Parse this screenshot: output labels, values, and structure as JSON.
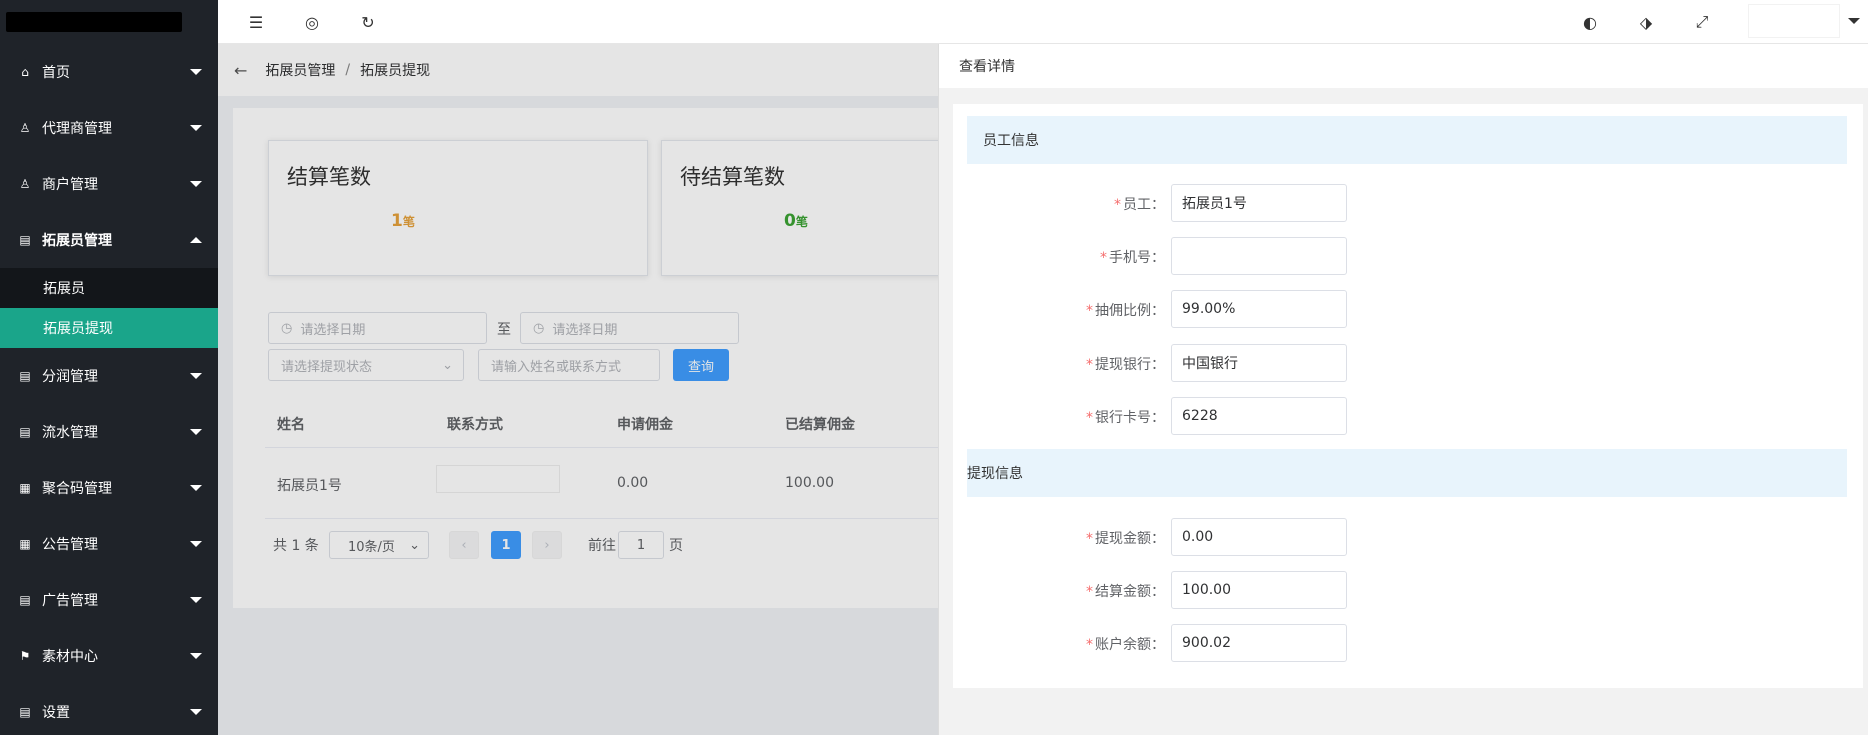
{
  "sidebar": {
    "menu": [
      {
        "label": "首页",
        "icon": "home-icon"
      },
      {
        "label": "代理商管理",
        "icon": "user-icon"
      },
      {
        "label": "商户管理",
        "icon": "user-icon"
      },
      {
        "label": "拓展员管理",
        "icon": "clipboard-icon"
      },
      {
        "label": "分润管理",
        "icon": "clipboard-icon"
      },
      {
        "label": "流水管理",
        "icon": "clipboard-icon"
      },
      {
        "label": "聚合码管理",
        "icon": "qrcode-icon"
      },
      {
        "label": "公告管理",
        "icon": "qrcode-icon"
      },
      {
        "label": "广告管理",
        "icon": "clipboard-icon"
      },
      {
        "label": "素材中心",
        "icon": "flag-icon"
      },
      {
        "label": "设置",
        "icon": "clipboard-icon"
      }
    ],
    "submenu": [
      {
        "label": "拓展员"
      },
      {
        "label": "拓展员提现"
      }
    ]
  },
  "breadcrumb": {
    "parent": "拓展员管理",
    "separator": "/",
    "current": "拓展员提现"
  },
  "stats": [
    {
      "title": "结算笔数",
      "value": "1",
      "unit": "笔",
      "color": "#e6a23c"
    },
    {
      "title": "待结算笔数",
      "value": "0",
      "unit": "笔",
      "color": "#3ba334"
    }
  ],
  "filters": {
    "start_date_placeholder": "请选择日期",
    "to_label": "至",
    "end_date_placeholder": "请选择日期",
    "status_placeholder": "请选择提现状态",
    "keyword_placeholder": "请输入姓名或联系方式",
    "query_label": "查询"
  },
  "table": {
    "headers": [
      "姓名",
      "联系方式",
      "申请佣金",
      "已结算佣金"
    ],
    "rows": [
      {
        "name": "拓展员1号",
        "contact": "",
        "applied": "0.00",
        "settled": "100.00"
      }
    ]
  },
  "pagination": {
    "total_label": "共 1 条",
    "page_size": "10条/页",
    "current_page": "1",
    "goto_label": "前往",
    "goto_value": "1",
    "page_suffix": "页"
  },
  "drawer": {
    "title": "查看详情",
    "section_employee": "员工信息",
    "section_withdraw": "提现信息",
    "fields": [
      {
        "label": "员工：",
        "value": "拓展员1号"
      },
      {
        "label": "手机号：",
        "value": ""
      },
      {
        "label": "抽佣比例：",
        "value": "99.00%"
      },
      {
        "label": "提现银行：",
        "value": "中国银行"
      },
      {
        "label": "银行卡号：",
        "value": "6228"
      }
    ],
    "withdraw_fields": [
      {
        "label": "提现金额：",
        "value": "0.00"
      },
      {
        "label": "结算金额：",
        "value": "100.00"
      },
      {
        "label": "账户余额：",
        "value": "900.02"
      }
    ]
  },
  "colors": {
    "sidebar_bg": "#1f2329",
    "active": "#1aa58a",
    "primary": "#409eff",
    "required": "#f56c6c"
  }
}
